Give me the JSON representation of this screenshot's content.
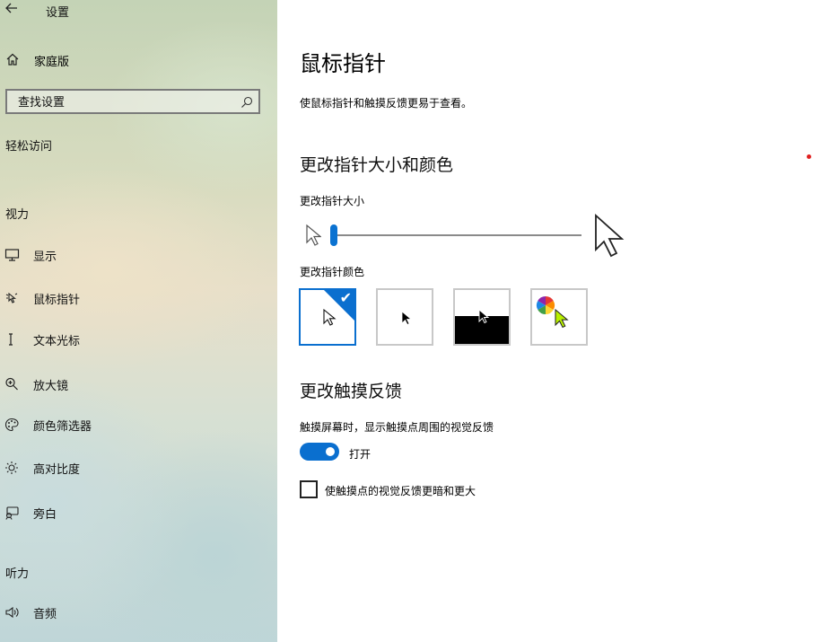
{
  "app": {
    "title": "设置",
    "back_icon": "back-arrow-icon"
  },
  "sidebar": {
    "home": {
      "label": "家庭版",
      "icon": "home-icon"
    },
    "search": {
      "placeholder": "查找设置",
      "icon": "search-icon"
    },
    "category": "轻松访问",
    "sections": [
      {
        "title": "视力"
      },
      {
        "title": "听力"
      }
    ],
    "items": [
      {
        "label": "显示",
        "icon": "monitor-icon"
      },
      {
        "label": "鼠标指针",
        "icon": "mouse-pointer-icon"
      },
      {
        "label": "文本光标",
        "icon": "text-cursor-icon"
      },
      {
        "label": "放大镜",
        "icon": "magnifier-icon"
      },
      {
        "label": "颜色筛选器",
        "icon": "color-palette-icon"
      },
      {
        "label": "高对比度",
        "icon": "contrast-sun-icon"
      },
      {
        "label": "旁白",
        "icon": "narrator-icon"
      },
      {
        "label": "音频",
        "icon": "speaker-icon"
      }
    ]
  },
  "main": {
    "title": "鼠标指针",
    "description": "使鼠标指针和触摸反馈更易于查看。",
    "pointer_section": {
      "heading": "更改指针大小和颜色",
      "size_label": "更改指针大小",
      "size_value": 1,
      "color_label": "更改指针颜色",
      "color_options": [
        {
          "name": "white",
          "selected": true
        },
        {
          "name": "black",
          "selected": false
        },
        {
          "name": "inverted",
          "selected": false
        },
        {
          "name": "custom",
          "selected": false
        }
      ]
    },
    "touch_section": {
      "heading": "更改触摸反馈",
      "toggle_label": "触摸屏幕时，显示触摸点周围的视觉反馈",
      "toggle_state": "打开",
      "toggle_on": true,
      "checkbox_label": "使触摸点的视觉反馈更暗和更大",
      "checkbox_checked": false
    }
  },
  "colors": {
    "accent": "#0a6fcf"
  }
}
